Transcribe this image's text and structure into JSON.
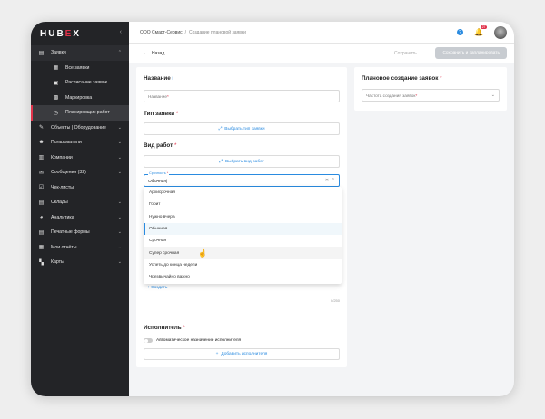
{
  "app": {
    "logo_left": "HUB",
    "logo_e": "E",
    "logo_right": "X"
  },
  "sidebar": {
    "items": [
      {
        "label": "Заявки",
        "icon": "requests-icon"
      },
      {
        "label": "Все заявки",
        "icon": "list-icon"
      },
      {
        "label": "Расписание заявок",
        "icon": "calendar-icon"
      },
      {
        "label": "Маркировка",
        "icon": "qr-icon"
      },
      {
        "label": "Планировщик работ",
        "icon": "clock-icon"
      },
      {
        "label": "Объекты | Оборудование",
        "icon": "wrench-icon"
      },
      {
        "label": "Пользователи",
        "icon": "users-icon"
      },
      {
        "label": "Компании",
        "icon": "building-icon"
      },
      {
        "label": "Сообщения (32)",
        "icon": "chat-icon"
      },
      {
        "label": "Чек-листы",
        "icon": "checklist-icon"
      },
      {
        "label": "Склады",
        "icon": "warehouse-icon"
      },
      {
        "label": "Аналитика",
        "icon": "chart-icon"
      },
      {
        "label": "Печатные формы",
        "icon": "print-icon"
      },
      {
        "label": "Мои отчёты",
        "icon": "report-icon"
      },
      {
        "label": "Карты",
        "icon": "map-icon"
      }
    ]
  },
  "topbar": {
    "company": "ООО Смарт-Сервис",
    "separator": "/",
    "current": "Создание плановой заявки",
    "help": "?",
    "badge": "27"
  },
  "actionbar": {
    "back": "Назад",
    "save": "Сохранить",
    "save_plan": "Сохранить и запланировать"
  },
  "form": {
    "name_title": "Название",
    "name_info": "i",
    "name_placeholder": "Название",
    "type_title": "Тип заявки",
    "type_button": "Выбрать тип заявки",
    "work_title": "Вид работ",
    "work_button": "Выбрать вид работ",
    "urgency_label": "Срочность",
    "urgency_value": "Обычная|",
    "create_label": "Создать",
    "counter": "0/250",
    "executor_title": "Исполнитель",
    "auto_assign": "Автоматическое назначение исполнителя",
    "add_executor": "Добавить исполнителя"
  },
  "dropdown": {
    "options": [
      "Архисрочная",
      "Горит",
      "Нужно вчера",
      "Обычная",
      "Срочная",
      "Супер срочная",
      "Успеть до конца недели",
      "Чрезвычайно важно"
    ],
    "selected": "Обычная",
    "hovered": "Супер срочная"
  },
  "plan": {
    "title": "Плановое создание заявок",
    "frequency_placeholder": "Частота создания заявок"
  }
}
